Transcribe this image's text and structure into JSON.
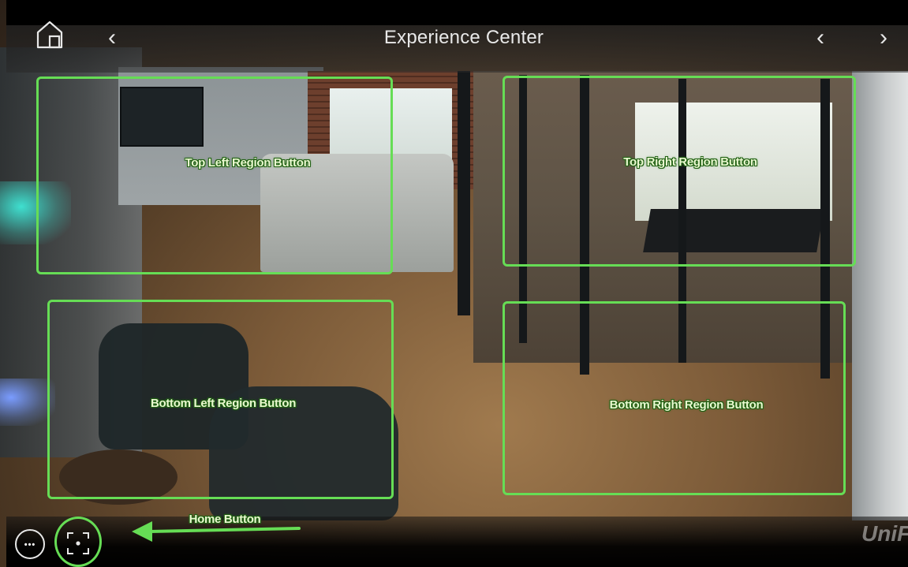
{
  "header": {
    "title": "Experience Center",
    "home_icon": "home-icon",
    "prev_icon": "chevron-left-icon",
    "back_icon": "chevron-left-icon",
    "next_icon": "chevron-right-icon",
    "prev_glyph": "‹",
    "next_glyph": "›"
  },
  "regions": {
    "top_left": {
      "label": "Top Left Region Button"
    },
    "top_right": {
      "label": "Top Right Region Button"
    },
    "bottom_left": {
      "label": "Bottom Left Region Button"
    },
    "bottom_right": {
      "label": "Bottom Right Region Button"
    }
  },
  "bottom_bar": {
    "more_glyph": "•••",
    "more_icon": "more-options-icon",
    "home_button_icon": "focus-center-icon",
    "home_button_label": "Home Button",
    "watermark": "UniF"
  },
  "colors": {
    "highlight": "#66dd55",
    "label_text": "#eaf9d0",
    "label_outline": "#1f5f12",
    "header_text": "#e8e8e8"
  }
}
